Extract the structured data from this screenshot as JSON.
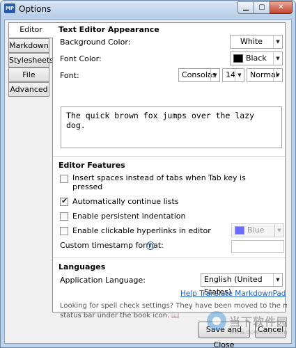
{
  "window": {
    "title": "Options",
    "app_icon": "MP",
    "minimize": "▁",
    "maximize": "▢",
    "close": "✕"
  },
  "tabs": [
    {
      "label": "Editor",
      "active": true
    },
    {
      "label": "Markdown"
    },
    {
      "label": "Stylesheets"
    },
    {
      "label": "File"
    },
    {
      "label": "Advanced"
    }
  ],
  "appearance": {
    "title": "Text Editor Appearance",
    "background_label": "Background Color:",
    "background_value": "White",
    "background_swatch": "#ffffff",
    "font_color_label": "Font Color:",
    "font_color_value": "Black",
    "font_color_swatch": "#000000",
    "font_label": "Font:",
    "font_family": "Consolas",
    "font_size": "14",
    "font_weight": "Normal",
    "preview_text": "The quick brown fox jumps over the lazy dog."
  },
  "features": {
    "title": "Editor Features",
    "items": [
      {
        "label_line1": "Insert spaces instead of tabs when Tab key is",
        "label_line2": "pressed",
        "checked": false
      },
      {
        "label": "Automatically continue lists",
        "checked": true
      },
      {
        "label": "Enable persistent indentation",
        "checked": false
      },
      {
        "label": "Enable clickable hyperlinks in editor",
        "checked": false
      }
    ],
    "hyperlink_color": "Blue",
    "hyperlink_swatch": "#6a6aff",
    "timestamp_label": "Custom timestamp format:",
    "timestamp_value": "",
    "info_icon": "i"
  },
  "languages": {
    "title": "Languages",
    "app_language_label": "Application Language:",
    "app_language_value": "English (United States)",
    "help_link": "Help Translate MarkdownPad",
    "note_line1": "Looking for spell check settings? They have been moved to the main applicatior",
    "note_line2": "status bar under the book icon."
  },
  "buttons": {
    "save_close": "Save and Close",
    "cancel": "Cancel"
  },
  "watermark": {
    "text": "当下软件园",
    "url": "www.downxia.com"
  },
  "icons": {
    "dropdown": "▼",
    "book": "📖"
  }
}
